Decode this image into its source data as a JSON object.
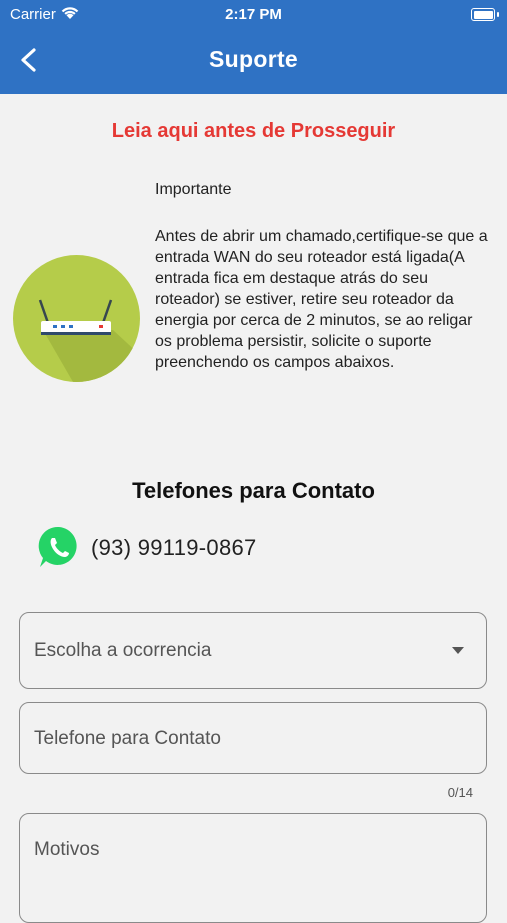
{
  "status_bar": {
    "carrier": "Carrier",
    "time": "2:17 PM"
  },
  "header": {
    "title": "Suporte",
    "back_icon": "chevron-left-icon",
    "color": "#2f72c4"
  },
  "notice": {
    "heading": "Leia aqui antes de Prosseguir",
    "heading_color": "#e53935",
    "image_icon": "router-icon",
    "label": "Importante",
    "body": "Antes de abrir um chamado,certifique-se que a entrada WAN do seu roteador está ligada(A entrada fica em destaque atrás do seu roteador) se estiver, retire seu roteador da energia por cerca de 2 minutos, se ao religar os problema persistir, solicite o suporte preenchendo os campos abaixos."
  },
  "contacts": {
    "title": "Telefones para Contato",
    "phone": "(93) 99119-0867",
    "phone_icon": "whatsapp-icon",
    "icon_color": "#25d366"
  },
  "form": {
    "occurrence_placeholder": "Escolha a ocorrencia",
    "phone_placeholder": "Telefone para Contato",
    "phone_counter": "0/14",
    "reasons_placeholder": "Motivos"
  }
}
